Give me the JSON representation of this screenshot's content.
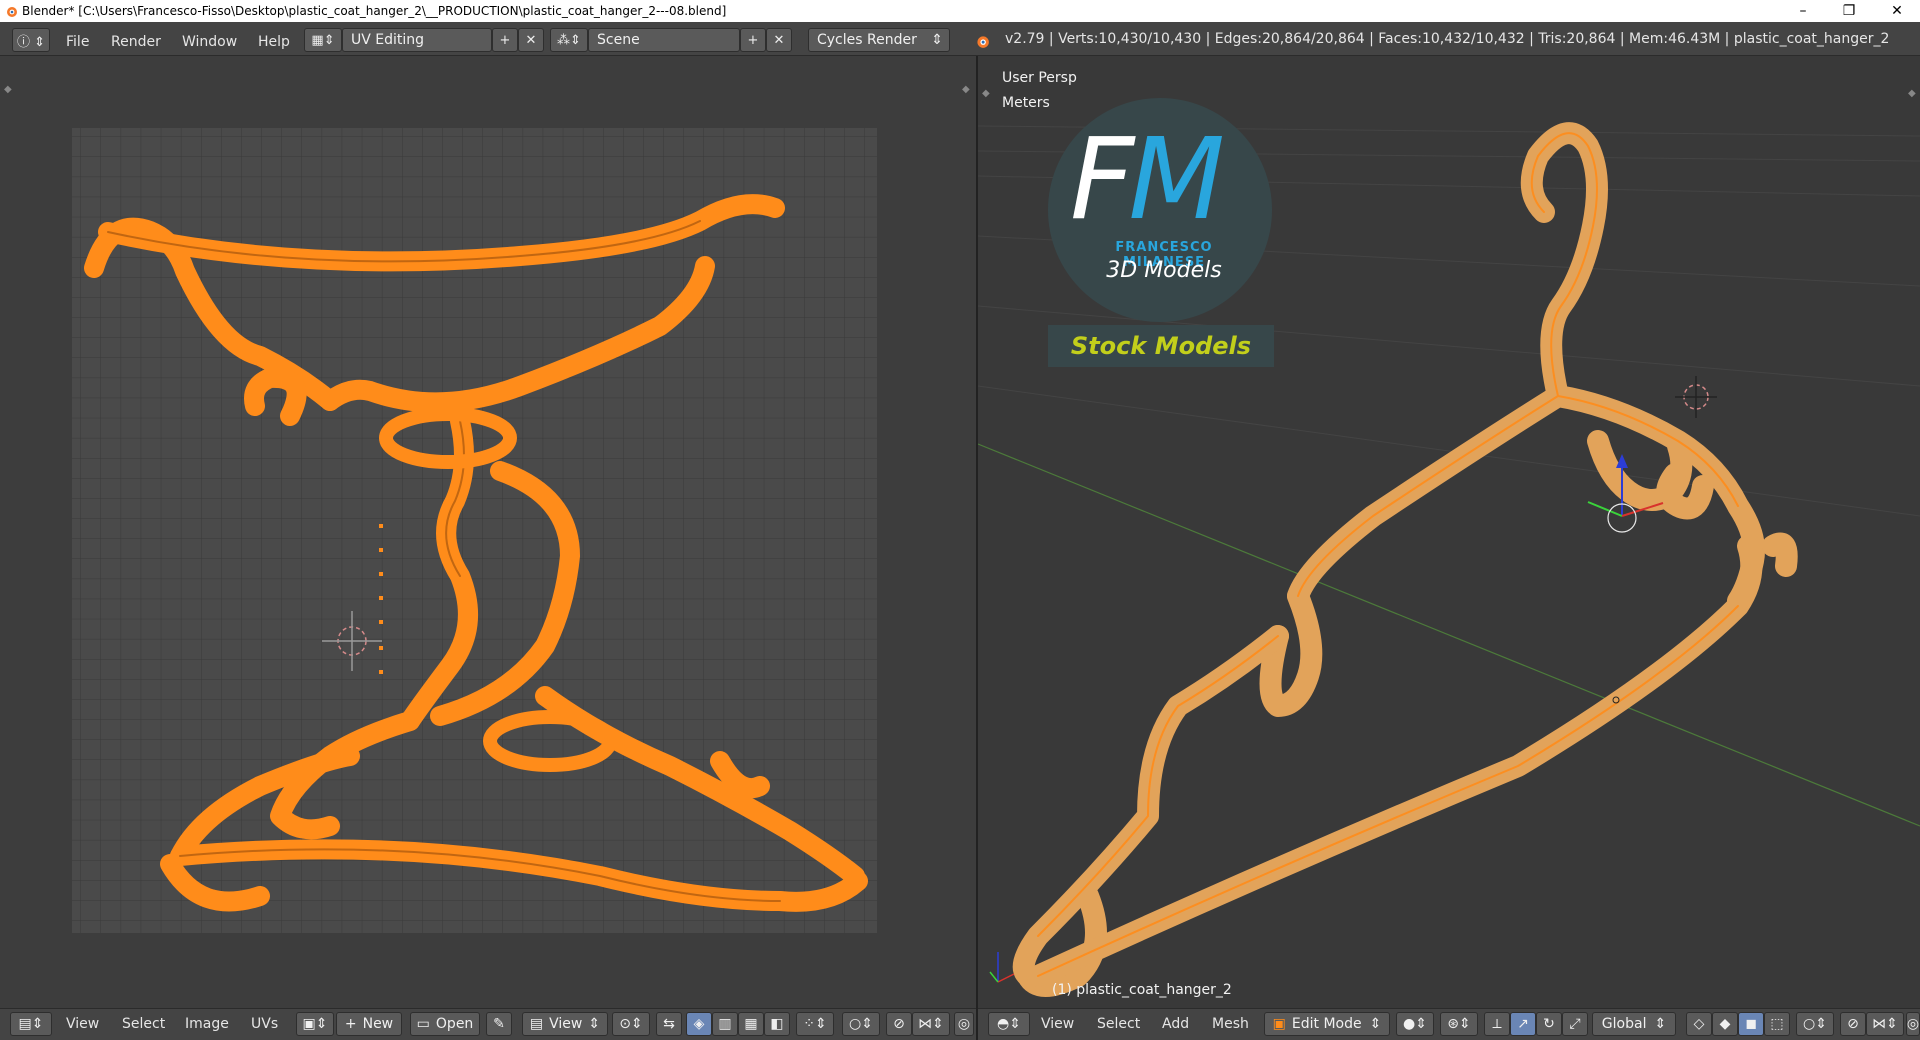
{
  "window": {
    "title": "Blender* [C:\\Users\\Francesco-Fisso\\Desktop\\plastic_coat_hanger_2\\__PRODUCTION\\plastic_coat_hanger_2---08.blend]",
    "minimize": "–",
    "maximize": "❐",
    "close": "✕"
  },
  "menu": {
    "file": "File",
    "render": "Render",
    "window": "Window",
    "help": "Help"
  },
  "layout": {
    "screen": "UV Editing",
    "scene": "Scene",
    "engine": "Cycles Render"
  },
  "stats": "v2.79 | Verts:10,430/10,430 | Edges:20,864/20,864 | Faces:10,432/10,432 | Tris:20,864 | Mem:46.43M | plastic_coat_hanger_2",
  "uv_editor": {
    "footer": {
      "view": "View",
      "select": "Select",
      "image": "Image",
      "uvs": "UVs",
      "new": "New",
      "open": "Open",
      "view_btn": "View"
    }
  },
  "viewport": {
    "projection": "User Persp",
    "units": "Meters",
    "object_label": "(1) plastic_coat_hanger_2",
    "logo": {
      "initial_f": "F",
      "initial_m": "M",
      "name": "FRANCESCO MILANESE",
      "tagline": "3D Models",
      "banner": "Stock Models"
    },
    "footer": {
      "view": "View",
      "select": "Select",
      "add": "Add",
      "mesh": "Mesh",
      "mode": "Edit Mode",
      "orientation": "Global"
    }
  },
  "colors": {
    "accent_orange": "#ff8c1a",
    "mesh_body": "#e2a35a",
    "logo_blue": "#29a6dd",
    "logo_green": "#c2cf1b"
  }
}
